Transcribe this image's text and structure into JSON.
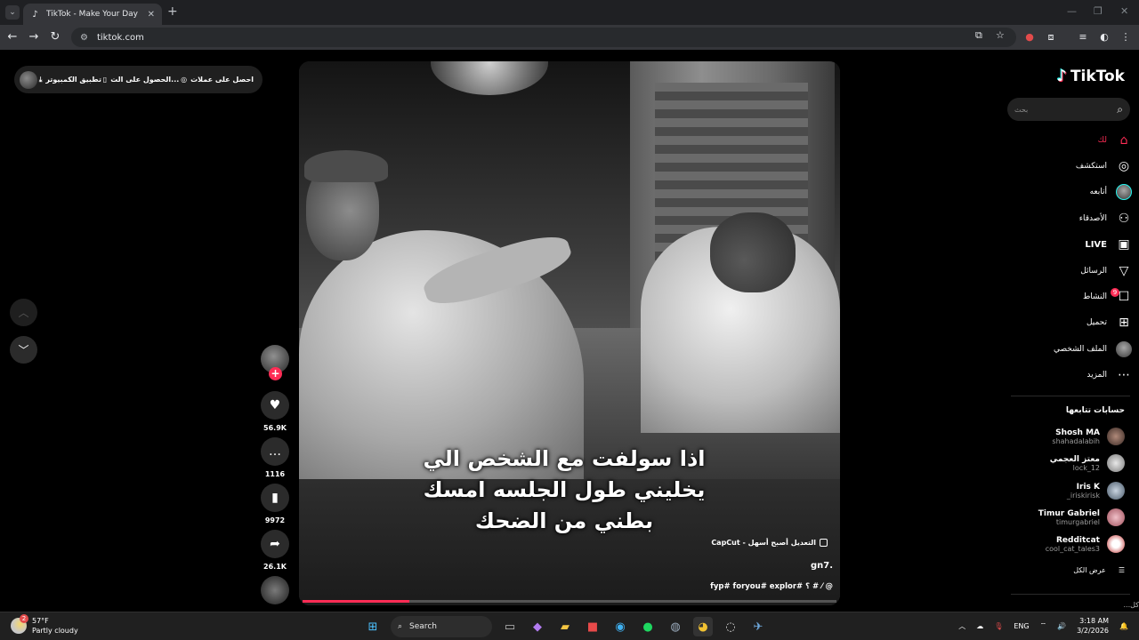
{
  "browser": {
    "tab_title": "TikTok - Make Your Day",
    "tab_favicon": "tiktok-note-icon",
    "url": "tiktok.com"
  },
  "top_bar": {
    "get_coins": "احصل على عملات",
    "get_app": "الحصول على الت...",
    "desktop_app": "تطبيق الكمبيوتر"
  },
  "video": {
    "caption_lines": [
      "اذا سولفت مع الشخص الي",
      "يخليني طول الجلسه امسك",
      "بطني من الضحك"
    ],
    "capcut_label": "CapCut - التعديل أصبح أسهل",
    "description": "gn7.",
    "hashtags": "fyp# foryou# explor#  ؟ # ⁄ @",
    "progress_fraction": 0.2
  },
  "actions": {
    "likes": "56.9K",
    "comments": "1116",
    "saves": "9972",
    "shares": "26.1K"
  },
  "sidebar": {
    "logo": "TikTok",
    "search_placeholder": "بحث",
    "nav": [
      {
        "label": "لك",
        "icon": "home-icon"
      },
      {
        "label": "استكشف",
        "icon": "compass-icon"
      },
      {
        "label": "أتابعه",
        "icon": "following-avatar"
      },
      {
        "label": "الأصدقاء",
        "icon": "friends-icon"
      },
      {
        "label": "LIVE",
        "icon": "live-icon"
      },
      {
        "label": "الرسائل",
        "icon": "send-icon"
      },
      {
        "label": "النشاط",
        "icon": "activity-icon",
        "badge": "9"
      },
      {
        "label": "تحميل",
        "icon": "upload-icon"
      },
      {
        "label": "الملف الشخصي",
        "icon": "profile-avatar"
      },
      {
        "label": "المزيد",
        "icon": "more-icon"
      }
    ],
    "following_title": "حسابات تتابعها",
    "accounts": [
      {
        "name": "Shosh MA",
        "handle": "shahadalabih"
      },
      {
        "name": "معتز العجمي",
        "handle": "lock_12"
      },
      {
        "name": "Iris K",
        "handle": "_iriskirisk"
      },
      {
        "name": "Timur Gabriel",
        "handle": "timurgabriel"
      },
      {
        "name": "Redditcat",
        "handle": "cool_cat_tales3"
      }
    ],
    "see_all": "عرض الكل",
    "footer_fragment": "كل..."
  },
  "taskbar": {
    "weather_temp": "57°F",
    "weather_desc": "Partly cloudy",
    "weather_badge": "2",
    "search_label": "Search",
    "language": "ENG",
    "time": "3:18 AM",
    "date": "3/2/2026"
  },
  "colors": {
    "accent": "#fe2c55",
    "background": "#000000",
    "chrome": "#35363a"
  }
}
